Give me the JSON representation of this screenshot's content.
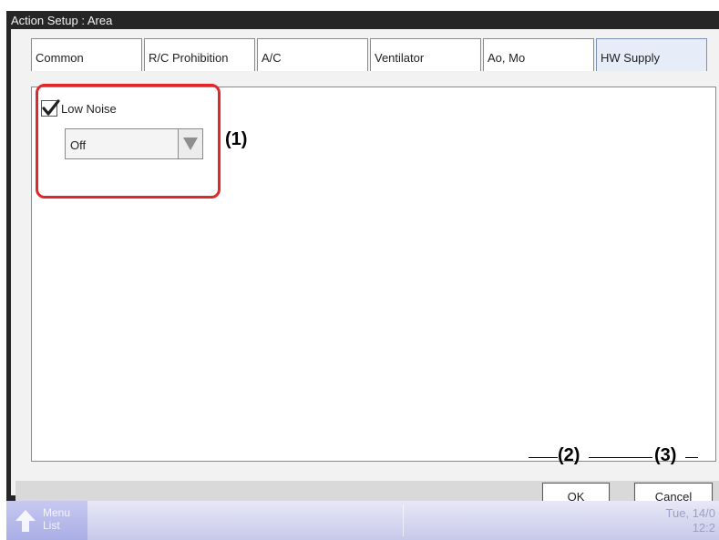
{
  "dialog": {
    "title": "Action Setup : Area"
  },
  "tabs": [
    {
      "label": "Common"
    },
    {
      "label": "R/C Prohibition"
    },
    {
      "label": "A/C"
    },
    {
      "label": "Ventilator"
    },
    {
      "label": "Ao, Mo"
    },
    {
      "label": "HW Supply",
      "active": true
    }
  ],
  "content": {
    "low_noise": {
      "label": "Low Noise",
      "checked": true
    },
    "select": {
      "value": "Off"
    }
  },
  "annotations": {
    "a1": "(1)",
    "a2": "(2)",
    "a3": "(3)"
  },
  "footer": {
    "ok_label": "OK",
    "cancel_label": "Cancel"
  },
  "taskbar": {
    "menu_line1": "Menu",
    "menu_line2": "List",
    "date": "Tue, 14/0",
    "time": "12:2"
  },
  "colors": {
    "callout": "#e0282b",
    "active_tab": "#e6edf8",
    "taskbar": "#c7c9ea"
  }
}
